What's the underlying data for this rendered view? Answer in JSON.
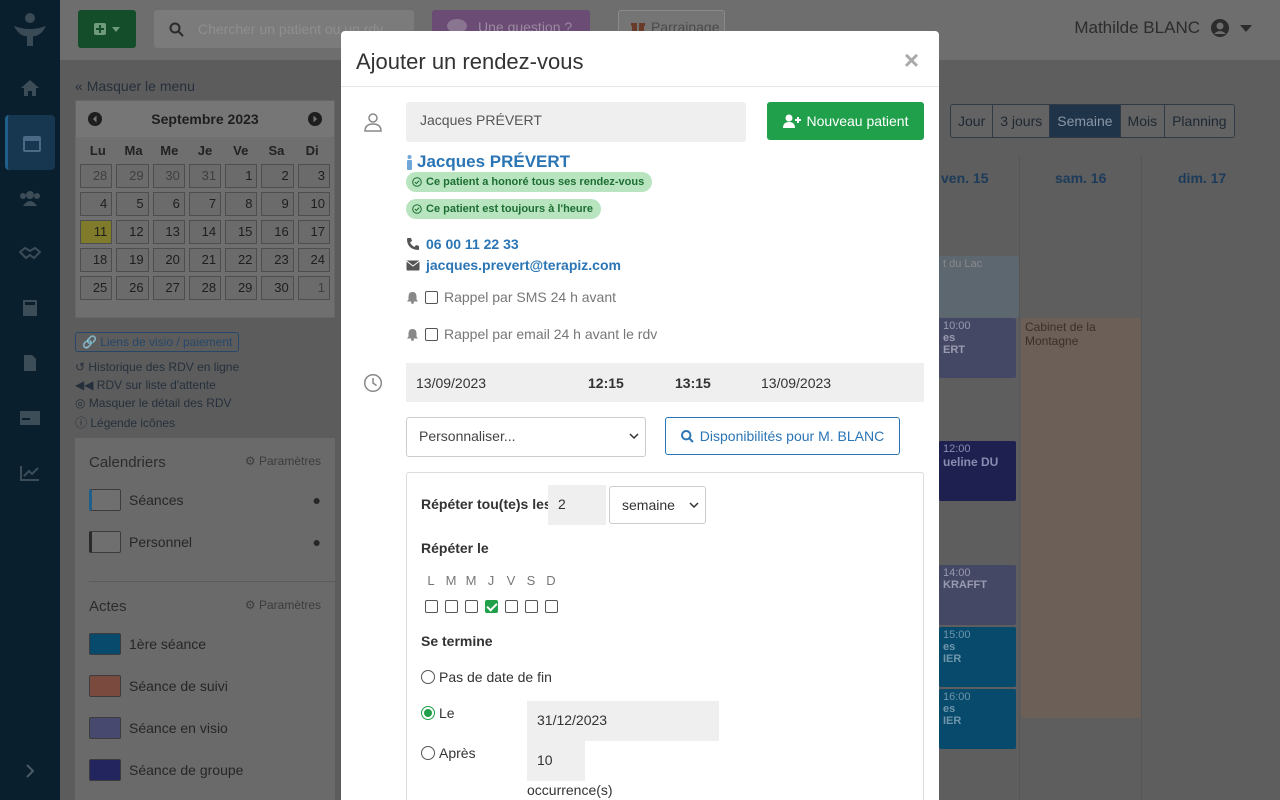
{
  "topbar": {
    "search_placeholder": "Chercher un patient ou un rdv",
    "question_label": "Une question ?",
    "parrainage_label": "Parrainage",
    "user_name": "Mathilde BLANC"
  },
  "sidebar": {
    "hide_menu": "Masquer le menu",
    "minical": {
      "month": "Septembre 2023",
      "dows": [
        "Lu",
        "Ma",
        "Me",
        "Je",
        "Ve",
        "Sa",
        "Di"
      ],
      "days": [
        "28",
        "29",
        "30",
        "31",
        "1",
        "2",
        "3",
        "4",
        "5",
        "6",
        "7",
        "8",
        "9",
        "10",
        "11",
        "12",
        "13",
        "14",
        "15",
        "16",
        "17",
        "18",
        "19",
        "20",
        "21",
        "22",
        "23",
        "24",
        "25",
        "26",
        "27",
        "28",
        "29",
        "30",
        "1"
      ]
    },
    "links": {
      "visio": "Liens de visio / paiement",
      "history": "Historique des RDV en ligne",
      "waitlist": "RDV sur liste d'attente",
      "hide_details": "Masquer le détail des RDV",
      "legend": "Légende icônes"
    },
    "calendars": {
      "title": "Calendriers",
      "settings": "Paramètres",
      "items": [
        "Séances",
        "Personnel"
      ]
    },
    "actes": {
      "title": "Actes",
      "settings": "Paramètres",
      "items": [
        "1ère séance",
        "Séance de suivi",
        "Séance en visio",
        "Séance de groupe"
      ]
    }
  },
  "calendar": {
    "views": [
      "Jour",
      "3 jours",
      "Semaine",
      "Mois",
      "Planning"
    ],
    "active_view": "Semaine",
    "days": [
      "ven. 15",
      "sam. 16",
      "dim. 17"
    ],
    "events": {
      "lac": "t du Lac",
      "e1000": "10:00",
      "e1000b": "es",
      "e1000c": "ERT",
      "montagne": "Cabinet de la Montagne",
      "e1200": "12:00",
      "e1200b": "ueline DU",
      "e1400": "14:00",
      "e1400b": "KRAFFT",
      "e1500": "15:00",
      "e1500b": "es",
      "e1500c": "IER",
      "e1600": "16:00",
      "e1600b": "es",
      "e1600c": "IER"
    }
  },
  "modal": {
    "title": "Ajouter un rendez-vous",
    "patient_value": "Jacques PRÉVERT",
    "new_patient": "Nouveau patient",
    "patient_name": "Jacques PRÉVERT",
    "badge_honored": "Ce patient a honoré tous ses rendez-vous",
    "badge_ontime": "Ce patient est toujours à l'heure",
    "phone": "06 00 11 22 33",
    "email": "jacques.prevert@terapiz.com",
    "rappel_sms": "Rappel par SMS 24 h avant",
    "rappel_email": "Rappel par email 24 h avant le rdv",
    "date_start": "13/09/2023",
    "time_start": "12:15",
    "time_end": "13:15",
    "date_end": "13/09/2023",
    "personnaliser": "Personnaliser...",
    "dispo": "Disponibilités pour M. BLANC",
    "repeat": {
      "label": "Répéter tou(te)s les",
      "interval": "2",
      "unit": "semaine",
      "repeat_on": "Répéter le",
      "day_letters": [
        "L",
        "M",
        "M",
        "J",
        "V",
        "S",
        "D"
      ],
      "checked_day": "J",
      "ends": "Se termine",
      "no_end": "Pas de date de fin",
      "on": "Le",
      "end_date": "31/12/2023",
      "after": "Après",
      "occurrences": "10",
      "occ_label": "occurrence(s)"
    }
  }
}
